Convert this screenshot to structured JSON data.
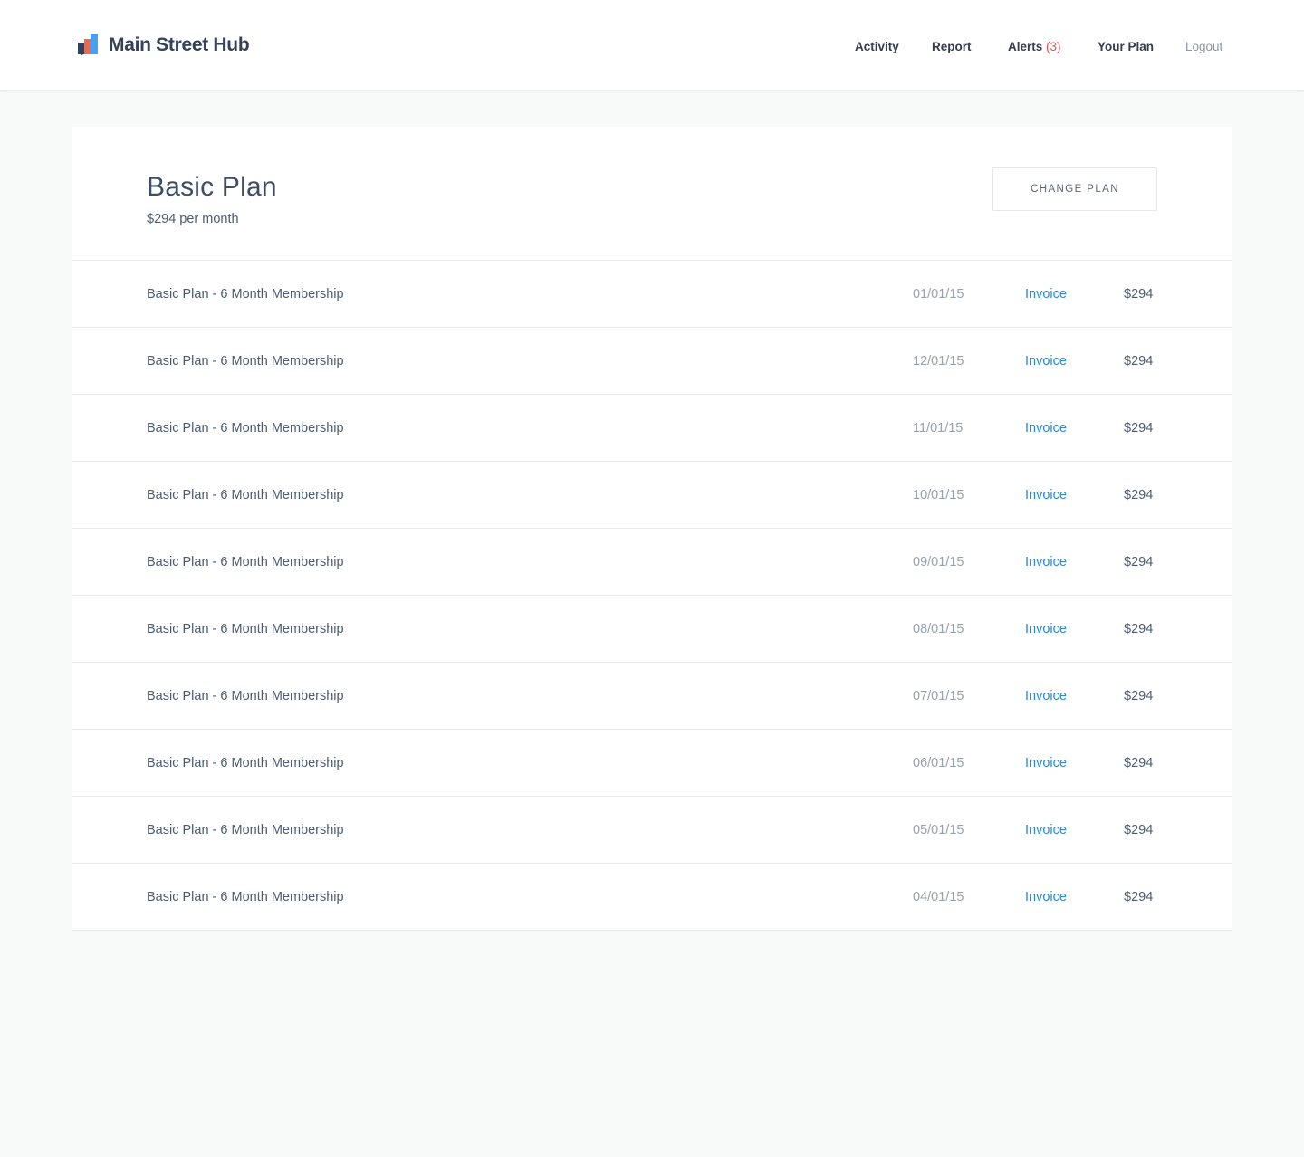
{
  "app": {
    "brand_name": "Main Street Hub",
    "logo_icon": "bar-chart-logo-icon"
  },
  "nav": {
    "activity": "Activity",
    "report": "Report",
    "alerts_label": "Alerts",
    "alerts_count": "(3)",
    "your_plan": "Your Plan",
    "logout": "Logout"
  },
  "plan": {
    "title": "Basic Plan",
    "price": "$294 per month",
    "change_button": "CHANGE PLAN"
  },
  "payments": [
    {
      "name": "Basic Plan - 6 Month Membership",
      "date": "01/01/15",
      "link": "Invoice",
      "amount": "$294"
    },
    {
      "name": "Basic Plan - 6 Month Membership",
      "date": "12/01/15",
      "link": "Invoice",
      "amount": "$294"
    },
    {
      "name": "Basic Plan - 6 Month Membership",
      "date": "11/01/15",
      "link": "Invoice",
      "amount": "$294"
    },
    {
      "name": "Basic Plan - 6 Month Membership",
      "date": "10/01/15",
      "link": "Invoice",
      "amount": "$294"
    },
    {
      "name": "Basic Plan - 6 Month Membership",
      "date": "09/01/15",
      "link": "Invoice",
      "amount": "$294"
    },
    {
      "name": "Basic Plan - 6 Month Membership",
      "date": "08/01/15",
      "link": "Invoice",
      "amount": "$294"
    },
    {
      "name": "Basic Plan - 6 Month Membership",
      "date": "07/01/15",
      "link": "Invoice",
      "amount": "$294"
    },
    {
      "name": "Basic Plan - 6 Month Membership",
      "date": "06/01/15",
      "link": "Invoice",
      "amount": "$294"
    },
    {
      "name": "Basic Plan - 6 Month Membership",
      "date": "05/01/15",
      "link": "Invoice",
      "amount": "$294"
    },
    {
      "name": "Basic Plan - 6 Month Membership",
      "date": "04/01/15",
      "link": "Invoice",
      "amount": "$294"
    }
  ],
  "colors": {
    "accent_link": "#2a8ad4",
    "alert": "#e8534a",
    "logo_blue": "#4a9ff0",
    "logo_orange": "#f0694a",
    "logo_navy": "#33415a"
  }
}
